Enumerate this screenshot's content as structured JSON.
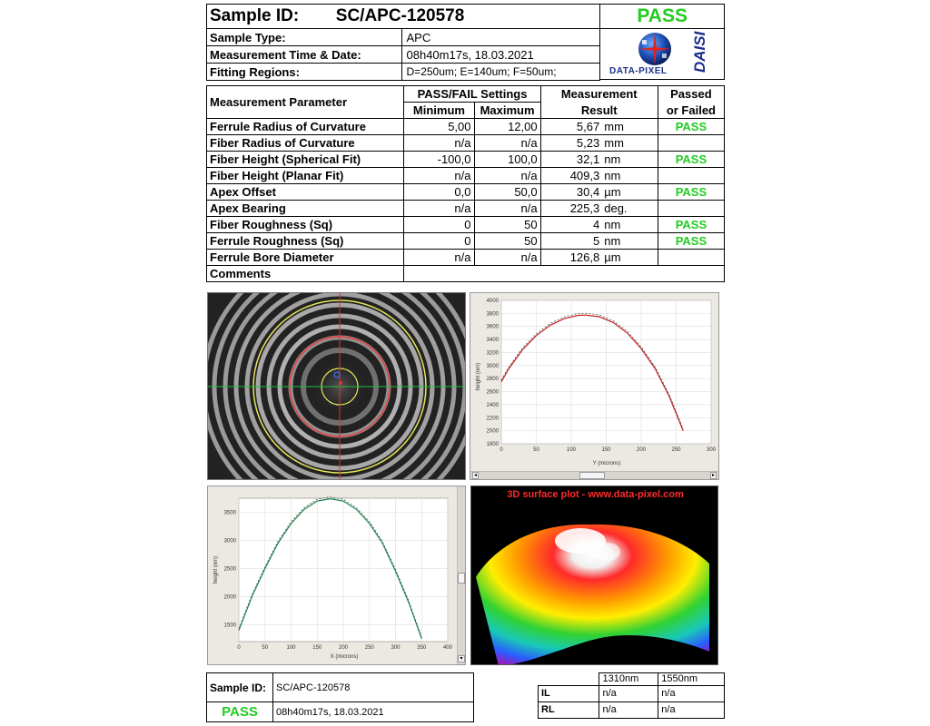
{
  "header": {
    "sample_id_label": "Sample ID:",
    "sample_id": "SC/APC-120578",
    "status": "PASS",
    "sample_type_label": "Sample Type:",
    "sample_type": "APC",
    "measurement_time_label": "Measurement Time & Date:",
    "measurement_time": "08h40m17s, 18.03.2021",
    "fitting_regions_label": "Fitting Regions:",
    "fitting_regions": "D=250um;  E=140um;  F=50um;",
    "logo_text": "DATA-PIXEL",
    "logo_side_text": "DAISI"
  },
  "table": {
    "col_param": "Measurement Parameter",
    "col_settings": "PASS/FAIL Settings",
    "col_min": "Minimum",
    "col_max": "Maximum",
    "col_result_1": "Measurement",
    "col_result_2": "Result",
    "col_passed_1": "Passed",
    "col_passed_2": "or Failed",
    "rows": [
      {
        "name": "Ferrule Radius of Curvature",
        "min": "5,00",
        "max": "12,00",
        "value": "5,67",
        "unit": "mm",
        "status": "PASS"
      },
      {
        "name": "Fiber Radius of Curvature",
        "min": "n/a",
        "max": "n/a",
        "value": "5,23",
        "unit": "mm",
        "status": ""
      },
      {
        "name": "Fiber Height (Spherical Fit)",
        "min": "-100,0",
        "max": "100,0",
        "value": "32,1",
        "unit": "nm",
        "status": "PASS"
      },
      {
        "name": "Fiber Height (Planar Fit)",
        "min": "n/a",
        "max": "n/a",
        "value": "409,3",
        "unit": "nm",
        "status": ""
      },
      {
        "name": "Apex Offset",
        "min": "0,0",
        "max": "50,0",
        "value": "30,4",
        "unit": "µm",
        "status": "PASS"
      },
      {
        "name": "Apex Bearing",
        "min": "n/a",
        "max": "n/a",
        "value": "225,3",
        "unit": "deg.",
        "status": ""
      },
      {
        "name": "Fiber Roughness (Sq)",
        "min": "0",
        "max": "50",
        "value": "4",
        "unit": "nm",
        "status": "PASS"
      },
      {
        "name": "Ferrule Roughness (Sq)",
        "min": "0",
        "max": "50",
        "value": "5",
        "unit": "nm",
        "status": "PASS"
      },
      {
        "name": "Ferrule Bore Diameter",
        "min": "n/a",
        "max": "n/a",
        "value": "126,8",
        "unit": "µm",
        "status": ""
      }
    ],
    "comments_label": "Comments"
  },
  "surface_plot": {
    "title": "3D surface plot - www.data-pixel.com"
  },
  "chart_data": [
    {
      "type": "line",
      "ylabel": "height (nm)",
      "xlabel": "Y (microns)",
      "xlim": [
        0,
        300
      ],
      "ylim": [
        1800,
        4000
      ],
      "xticks": [
        "0",
        "50",
        "100",
        "150",
        "200",
        "250",
        "300"
      ],
      "yticks": [
        "1800",
        "2000",
        "2200",
        "2400",
        "2600",
        "2800",
        "3000",
        "3200",
        "3400",
        "3600",
        "3800",
        "4000"
      ],
      "series": [
        {
          "x": [
            0,
            10,
            30,
            50,
            70,
            90,
            110,
            120,
            140,
            160,
            180,
            200,
            220,
            240,
            260
          ],
          "values": [
            2750,
            2940,
            3240,
            3460,
            3620,
            3720,
            3770,
            3775,
            3750,
            3660,
            3500,
            3260,
            2950,
            2530,
            2000
          ]
        }
      ]
    },
    {
      "type": "line",
      "ylabel": "height (nm)",
      "xlabel": "X (microns)",
      "xlim": [
        0,
        400
      ],
      "ylim": [
        1200,
        3750
      ],
      "xticks": [
        "0",
        "50",
        "100",
        "150",
        "200",
        "250",
        "300",
        "350",
        "400"
      ],
      "yticks": [
        "1500",
        "2000",
        "2500",
        "3000",
        "3500"
      ],
      "series": [
        {
          "x": [
            0,
            25,
            50,
            75,
            100,
            125,
            150,
            175,
            200,
            225,
            250,
            275,
            300,
            325,
            350
          ],
          "values": [
            1400,
            2000,
            2500,
            2950,
            3300,
            3550,
            3700,
            3740,
            3700,
            3550,
            3300,
            2950,
            2450,
            1900,
            1250
          ]
        }
      ]
    }
  ],
  "footer": {
    "sample_id_label": "Sample ID:",
    "sample_id": "SC/APC-120578",
    "status": "PASS",
    "datetime": "08h40m17s, 18.03.2021",
    "il_table": {
      "h1": "1310nm",
      "h2": "1550nm",
      "rows": [
        {
          "label": "IL",
          "v1": "n/a",
          "v2": "n/a"
        },
        {
          "label": "RL",
          "v1": "n/a",
          "v2": "n/a"
        }
      ]
    }
  }
}
